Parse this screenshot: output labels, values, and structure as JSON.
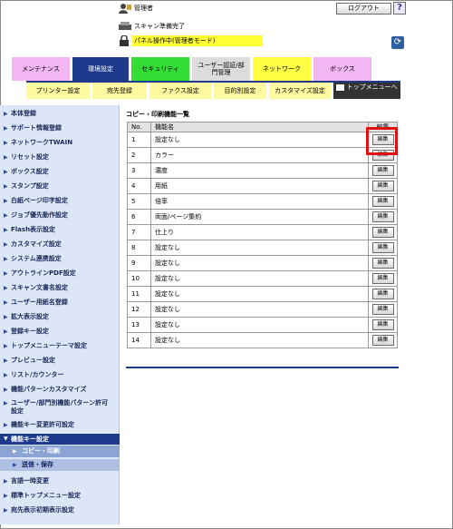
{
  "header": {
    "user_label": "管理者",
    "logout_label": "ログアウト",
    "help_label": "?",
    "status_label": "スキャン準備完了",
    "panel_status": "パネル操作中(管理者モード)",
    "refresh_icon": "refresh-icon"
  },
  "tabs": [
    {
      "label": "メンテナンス",
      "color": "#f2b7f2"
    },
    {
      "label": "環境設定",
      "color": "#1e3a8c",
      "active": true
    },
    {
      "label": "セキュリティ",
      "color": "#33dd33"
    },
    {
      "label": "ユーザー認証/部門管理",
      "color": "#dcdcdc"
    },
    {
      "label": "ネットワーク",
      "color": "#ffff44"
    },
    {
      "label": "ボックス",
      "color": "#f2b7f2"
    }
  ],
  "subtabs": [
    {
      "label": "プリンター設定"
    },
    {
      "label": "宛先登録"
    },
    {
      "label": "ファクス設定"
    },
    {
      "label": "目的別設定"
    },
    {
      "label": "カスタマイズ設定"
    },
    {
      "label": "トップメニューへ"
    }
  ],
  "sidebar": {
    "items": [
      {
        "label": "本体登録"
      },
      {
        "label": "サポート情報登録"
      },
      {
        "label": "ネットワークTWAIN"
      },
      {
        "label": "リセット設定"
      },
      {
        "label": "ボックス設定"
      },
      {
        "label": "スタンプ設定"
      },
      {
        "label": "白紙ページ印字設定"
      },
      {
        "label": "ジョブ優先動作設定"
      },
      {
        "label": "Flash表示設定"
      },
      {
        "label": "カスタマイズ設定"
      },
      {
        "label": "システム連携設定"
      },
      {
        "label": "アウトラインPDF設定"
      },
      {
        "label": "スキャン文書名設定"
      },
      {
        "label": "ユーザー用紙名登録"
      },
      {
        "label": "拡大表示設定"
      },
      {
        "label": "登録キー設定"
      },
      {
        "label": "トップメニューテーマ設定"
      },
      {
        "label": "プレビュー設定"
      },
      {
        "label": "リスト/カウンター"
      },
      {
        "label": "機能パターンカスタマイズ"
      },
      {
        "label": "ユーザー/部門別機能パターン許可設定"
      },
      {
        "label": "機能キー変更許可設定"
      },
      {
        "label": "機能キー設定"
      },
      {
        "label": "コピー・印刷"
      },
      {
        "label": "送信・保存"
      },
      {
        "label": "言語一時変更"
      },
      {
        "label": "標準トップメニュー設定"
      },
      {
        "label": "宛先表示初期表示設定"
      }
    ]
  },
  "main": {
    "title": "コピー・印刷機能一覧",
    "col_no": "No.",
    "col_name": "機能名",
    "col_edit": "編集",
    "edit_label": "編集",
    "rows": [
      {
        "no": "1",
        "name": "設定なし"
      },
      {
        "no": "2",
        "name": "カラー"
      },
      {
        "no": "3",
        "name": "濃度"
      },
      {
        "no": "4",
        "name": "用紙"
      },
      {
        "no": "5",
        "name": "倍率"
      },
      {
        "no": "6",
        "name": "両面/ページ集約"
      },
      {
        "no": "7",
        "name": "仕上り"
      },
      {
        "no": "8",
        "name": "設定なし"
      },
      {
        "no": "9",
        "name": "設定なし"
      },
      {
        "no": "10",
        "name": "設定なし"
      },
      {
        "no": "11",
        "name": "設定なし"
      },
      {
        "no": "12",
        "name": "設定なし"
      },
      {
        "no": "13",
        "name": "設定なし"
      },
      {
        "no": "14",
        "name": "設定なし"
      }
    ]
  }
}
